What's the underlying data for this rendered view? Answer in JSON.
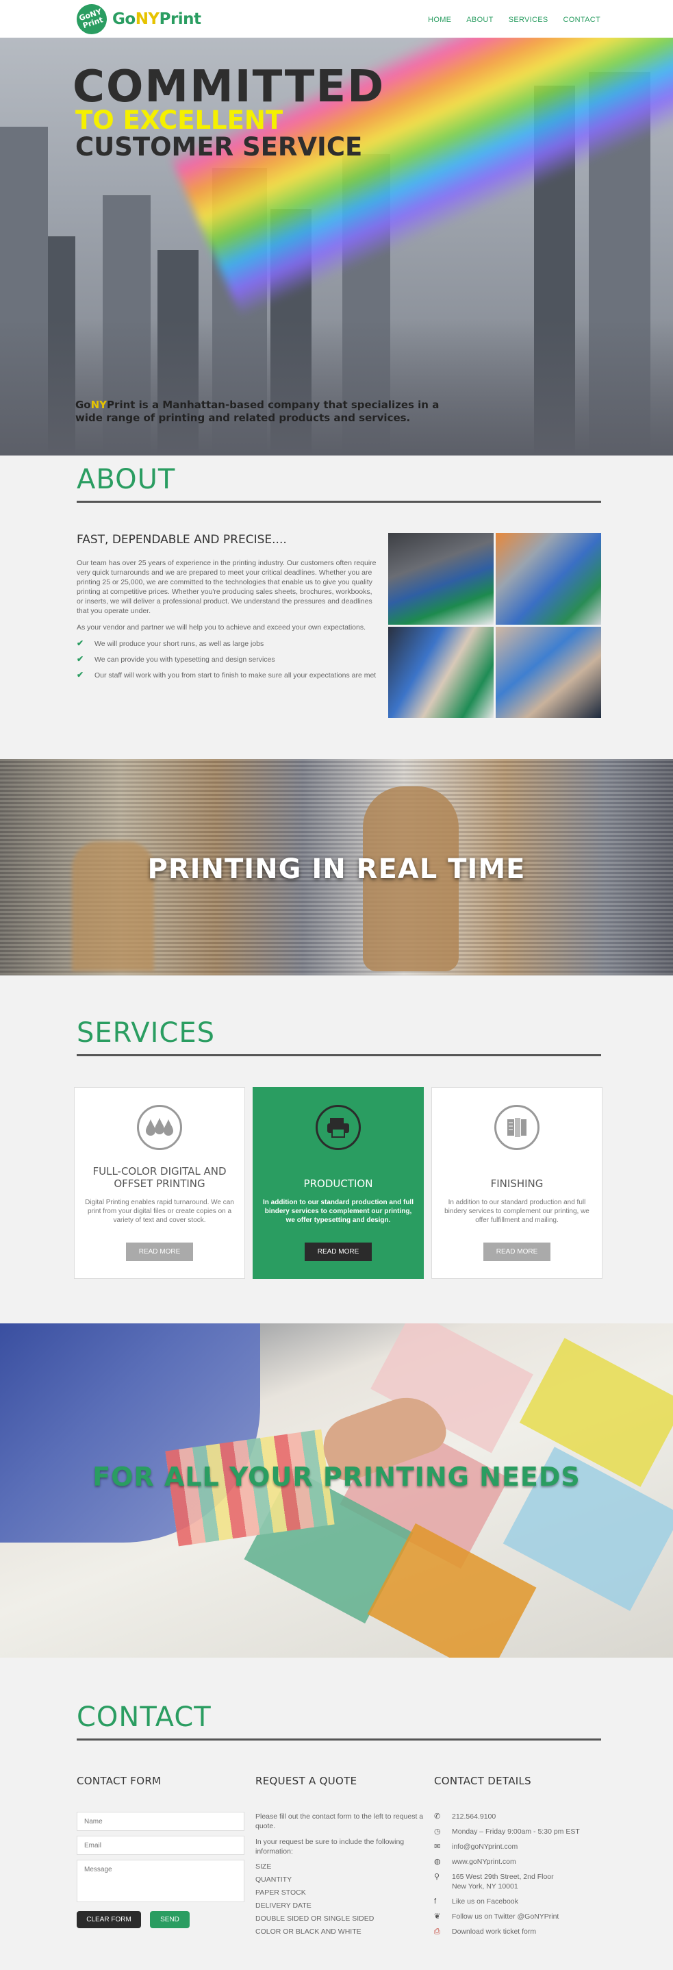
{
  "header": {
    "logo_badge": "GoNY Print",
    "logo_go": "Go",
    "logo_ny": "NY",
    "logo_print": "Print",
    "nav": [
      "HOME",
      "ABOUT",
      "SERVICES",
      "CONTACT"
    ]
  },
  "hero": {
    "line1": "COMMITTED",
    "line2": "TO EXCELLENT",
    "line3": "CUSTOMER SERVICE",
    "tagline_go": "Go",
    "tagline_ny": "NY",
    "tagline_rest": "Print is a Manhattan-based company that specializes in a wide range of printing and related products and services."
  },
  "about": {
    "title": "ABOUT",
    "subtitle": "FAST, DEPENDABLE AND PRECISE....",
    "paragraph1": "Our team has over 25 years of experience in the printing industry. Our customers often require very quick turnarounds and we are prepared to meet your critical deadlines. Whether you are printing 25 or 25,000, we are committed to the technologies that enable us to give you quality printing at competitive prices. Whether you're producing sales sheets, brochures, workbooks, or inserts, we will deliver a professional product. We understand the pressures and deadlines that you operate under.",
    "paragraph2": "As your vendor and partner we will help you to achieve and exceed your own expectations.",
    "checks": [
      "We will produce your short runs, as well as large jobs",
      "We can provide you with typesetting and design services",
      "Our staff will work with you from start to finish to make sure all your expectations are met"
    ]
  },
  "banner1": {
    "text": "PRINTING IN REAL TIME"
  },
  "services": {
    "title": "SERVICES",
    "cards": [
      {
        "icon": "ink-drops-icon",
        "title": "FULL-COLOR DIGITAL AND OFFSET PRINTING",
        "desc": "Digital Printing enables rapid turnaround. We can print from your digital files or create copies on a variety of text and cover stock.",
        "button": "READ MORE"
      },
      {
        "icon": "printer-icon",
        "title": "PRODUCTION",
        "desc": "In addition to our standard production and full bindery services to complement our printing, we offer typesetting and design.",
        "button": "READ MORE"
      },
      {
        "icon": "booklet-icon",
        "title": "FINISHING",
        "desc": "In addition to our standard production and full bindery services to complement our printing, we offer fulfillment and mailing.",
        "button": "READ MORE"
      }
    ]
  },
  "banner2": {
    "text": "FOR ALL YOUR PRINTING NEEDS"
  },
  "contact": {
    "title": "CONTACT",
    "form": {
      "heading": "CONTACT FORM",
      "name_placeholder": "Name",
      "email_placeholder": "Email",
      "message_placeholder": "Message",
      "clear_label": "CLEAR FORM",
      "send_label": "SEND"
    },
    "quote": {
      "heading": "REQUEST A QUOTE",
      "p1": "Please fill out the contact form to the left to request a quote.",
      "p2": "In your request be sure to include the following information:",
      "items": [
        "SIZE",
        "QUANTITY",
        "PAPER STOCK",
        "DELIVERY DATE",
        "DOUBLE SIDED OR SINGLE SIDED",
        "COLOR OR BLACK AND WHITE"
      ]
    },
    "details": {
      "heading": "CONTACT DETAILS",
      "items": [
        {
          "icon": "phone-icon",
          "glyph": "✆",
          "text": "212.564.9100"
        },
        {
          "icon": "clock-icon",
          "glyph": "◷",
          "text": "Monday – Friday 9:00am - 5:30 pm EST"
        },
        {
          "icon": "envelope-icon",
          "glyph": "✉",
          "text": "info@goNYprint.com"
        },
        {
          "icon": "globe-icon",
          "glyph": "◍",
          "text": "www.goNYprint.com"
        },
        {
          "icon": "map-pin-icon",
          "glyph": "⚲",
          "text": "165 West 29th Street, 2nd Floor\nNew York, NY 10001"
        },
        {
          "icon": "facebook-icon",
          "glyph": "f",
          "text": "Like us on Facebook"
        },
        {
          "icon": "twitter-icon",
          "glyph": "❦",
          "text": "Follow us on Twitter @GoNYPrint"
        },
        {
          "icon": "pdf-icon",
          "glyph": "⎙",
          "text": "Download work ticket form"
        }
      ]
    }
  },
  "colors": {
    "brand_green": "#2a9d61",
    "accent_yellow": "#f5f000",
    "dark": "#2b2b2b"
  }
}
